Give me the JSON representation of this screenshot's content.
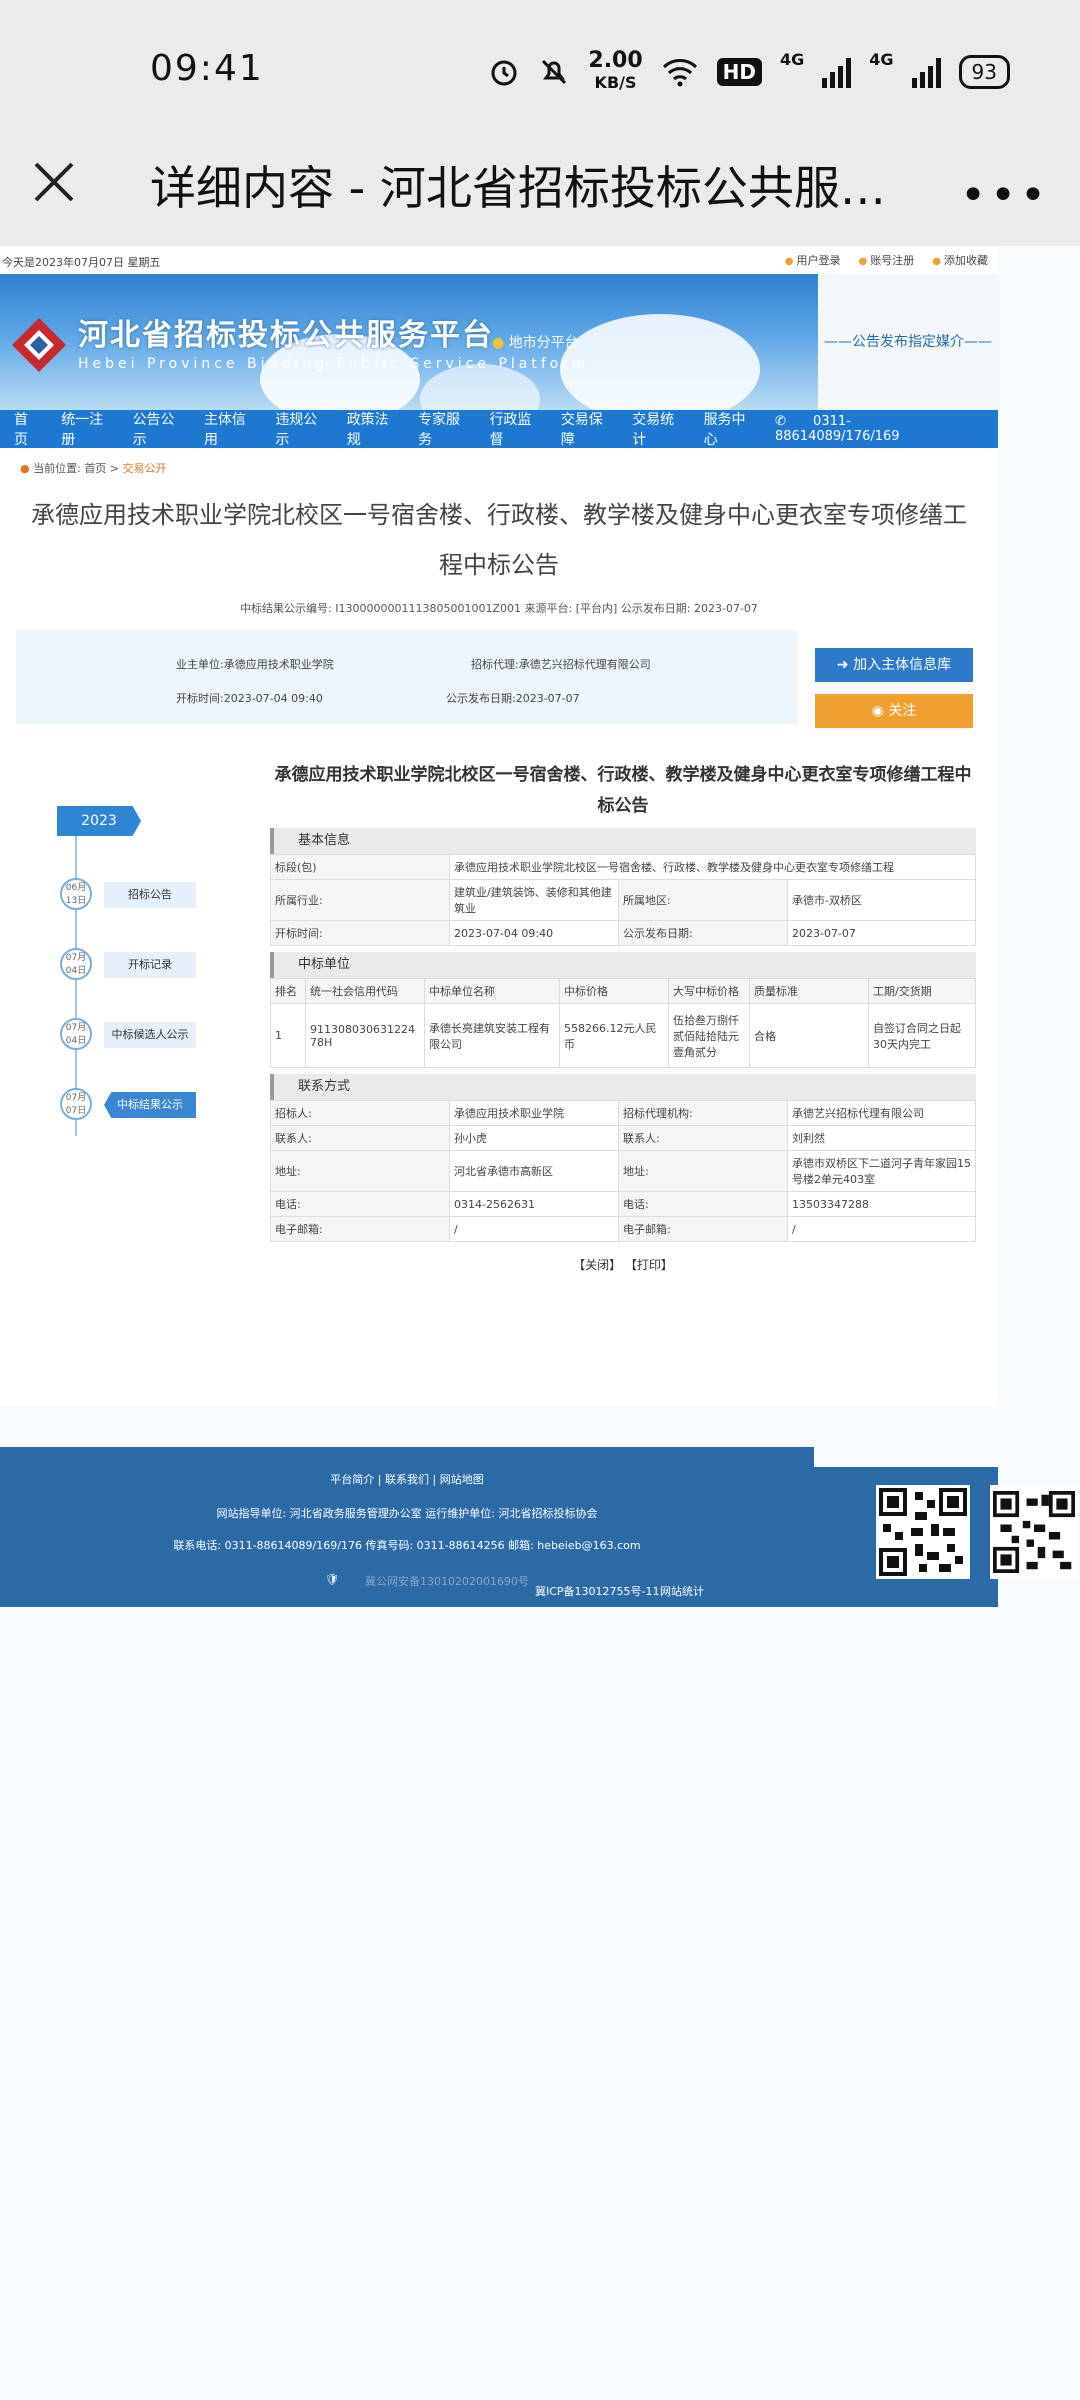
{
  "status_bar": {
    "time": "09:41",
    "net_speed_value": "2.00",
    "net_speed_unit": "KB/S",
    "hd_label": "HD",
    "sig1": "4G",
    "sig2": "4G",
    "battery": "93"
  },
  "browser": {
    "title": "详细内容 - 河北省招标投标公共服务...",
    "more": "•••"
  },
  "site": {
    "today": "今天是2023年07月07日 星期五",
    "top_links": [
      "用户登录",
      "账号注册",
      "添加收藏"
    ],
    "brand_cn": "河北省招标投标公共服务平台",
    "brand_en": "Hebei Province Bidding Public Service Platform",
    "city_button": "地市分平台",
    "slogan": "——公告发布指定媒介——",
    "nav": [
      "首页",
      "统一注册",
      "公告公示",
      "主体信用",
      "违规公示",
      "政策法规",
      "专家服务",
      "行政监督",
      "交易保障",
      "交易统计",
      "服务中心"
    ],
    "phone": "0311-88614089/176/169"
  },
  "breadcrumb": {
    "label": "当前位置:",
    "home": "首页 >",
    "current": "交易公开"
  },
  "announcement": {
    "title": "承德应用技术职业学院北校区一号宿舍楼、行政楼、教学楼及健身中心更衣室专项修缮工程中标公告",
    "meta": "中标结果公示编号: I1300000001113805001001Z001    来源平台: [平台内]    公示发布日期: 2023-07-07",
    "owner_label": "业主单位:",
    "owner": "承德应用技术职业学院",
    "agent_label": "招标代理:",
    "agent": "承德艺兴招标代理有限公司",
    "open_time_label": "开标时间:",
    "open_time": "2023-07-04 09:40",
    "publish_label": "公示发布日期:",
    "publish_date": "2023-07-07",
    "btn_add": "加入主体信息库",
    "btn_follow": "关注"
  },
  "timeline": {
    "year": "2023",
    "items": [
      {
        "date_top": "06月",
        "date_bottom": "13日",
        "label": "招标公告"
      },
      {
        "date_top": "07月",
        "date_bottom": "04日",
        "label": "开标记录"
      },
      {
        "date_top": "07月",
        "date_bottom": "04日",
        "label": "中标候选人公示"
      },
      {
        "date_top": "07月",
        "date_bottom": "07日",
        "label": "中标结果公示"
      }
    ]
  },
  "detail": {
    "heading": "承德应用技术职业学院北校区一号宿舍楼、行政楼、教学楼及健身中心更衣室专项修缮工程中标公告",
    "basic_title": "基本信息",
    "section_label": "标段(包)",
    "section_value": "承德应用技术职业学院北校区一号宿舍楼、行政楼、教学楼及健身中心更衣室专项修缮工程",
    "industry_label": "所属行业:",
    "industry_value": "建筑业/建筑装饰、装修和其他建筑业",
    "region_label": "所属地区:",
    "region_value": "承德市-双桥区",
    "open_label": "开标时间:",
    "open_value": "2023-07-04 09:40",
    "pub_label": "公示发布日期:",
    "pub_value": "2023-07-07",
    "winner_title": "中标单位",
    "winner_headers": [
      "排名",
      "统一社会信用代码",
      "中标单位名称",
      "中标价格",
      "大写中标价格",
      "质量标准",
      "工期/交货期"
    ],
    "winner_row": [
      "1",
      "91130803063122478H",
      "承德长亮建筑安装工程有限公司",
      "558266.12元人民币",
      "伍拾叁万捌仟贰佰陆拾陆元壹角贰分",
      "合格",
      "自签订合同之日起30天内完工"
    ],
    "contact_title": "联系方式",
    "contacts": [
      [
        "招标人:",
        "承德应用技术职业学院",
        "招标代理机构:",
        "承德艺兴招标代理有限公司"
      ],
      [
        "联系人:",
        "孙小虎",
        "联系人:",
        "刘利然"
      ],
      [
        "地址:",
        "河北省承德市高新区",
        "地址:",
        "承德市双桥区下二道河子青年家园15号楼2单元403室"
      ],
      [
        "电话:",
        "0314-2562631",
        "电话:",
        "13503347288"
      ],
      [
        "电子邮箱:",
        "/",
        "电子邮箱:",
        "/"
      ]
    ],
    "close_btn": "【关闭】",
    "print_btn": "【打印】"
  },
  "footer": {
    "links": "平台简介   |   联系我们   |   网站地图",
    "guide": "网站指导单位:  河北省政务服务管理办公室    运行维护单位:  河北省招标投标协会",
    "contact": "联系电话:   0311-88614089/169/176    传真号码:   0311-88614256    邮箱:   hebeieb@163.com",
    "record": "冀公网安备13010202001690号",
    "icp": "冀ICP备13012755号-11",
    "stats": "网站统计"
  }
}
